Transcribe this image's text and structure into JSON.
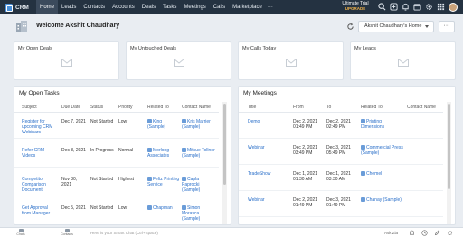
{
  "topbar": {
    "app_name": "CRM",
    "tabs": [
      "Home",
      "Leads",
      "Contacts",
      "Accounts",
      "Deals",
      "Tasks",
      "Meetings",
      "Calls",
      "Marketplace"
    ],
    "more": "···",
    "trial_line1": "Ultimate Trial",
    "trial_line2": "UPGRADE"
  },
  "welcome": {
    "text": "Welcome Akshit Chaudhary",
    "home_select": "Akshit Chaudhary's Home",
    "more": "···"
  },
  "cards": [
    "My Open Deals",
    "My Untouched Deals",
    "My Calls Today",
    "My Leads"
  ],
  "tasks": {
    "title": "My Open Tasks",
    "columns": [
      "Subject",
      "Due Date",
      "Status",
      "Priority",
      "Related To",
      "Contact Name"
    ],
    "rows": [
      {
        "subject": "Register for upcoming CRM Webinars",
        "due": "Dec 7, 2021",
        "status": "Not Started",
        "priority": "Low",
        "related": "King (Sample)",
        "contact": "Kris Marrier (Sample)"
      },
      {
        "subject": "Refer CRM Videos",
        "due": "Dec 8, 2021",
        "status": "In Progress",
        "priority": "Normal",
        "related": "Morlong Associates",
        "contact": "Mitsue Tollner (Sample)"
      },
      {
        "subject": "Competitor Comparison Document",
        "due": "Nov 30, 2021",
        "status": "Not Started",
        "priority": "Highest",
        "related": "Feltz Printing Service",
        "contact": "Capla Paprocki (Sample)"
      },
      {
        "subject": "Get Approval from Manager",
        "due": "Dec 5, 2021",
        "status": "Not Started",
        "priority": "Low",
        "related": "Chapman",
        "contact": "Simon Morasca (Sample)"
      }
    ]
  },
  "meetings": {
    "title": "My Meetings",
    "columns": [
      "Title",
      "From",
      "To",
      "Related To",
      "Contact Name"
    ],
    "rows": [
      {
        "title": "Demo",
        "from": "Dec 2, 2021\n01:49 PM",
        "to": "Dec 2, 2021\n02:49 PM",
        "related": "Printing Dimensions"
      },
      {
        "title": "Webinar",
        "from": "Dec 2, 2021\n03:49 PM",
        "to": "Dec 3, 2021\n05:49 PM",
        "related": "Commercial Press (Sample)"
      },
      {
        "title": "TradeShow",
        "from": "Dec 1, 2021\n01:30 AM",
        "to": "Dec 1, 2021\n03:30 AM",
        "related": "Chemel"
      },
      {
        "title": "Webinar",
        "from": "Dec 2, 2021\n01:49 PM",
        "to": "Dec 3, 2021\n01:49 PM",
        "related": "Chanay (Sample)"
      }
    ]
  },
  "bottombar": {
    "items": [
      "Chats",
      "Contacts"
    ],
    "search_placeholder": "Here is your Smart Chat (Ctrl+Space)",
    "right_label": "Ask Zia"
  }
}
